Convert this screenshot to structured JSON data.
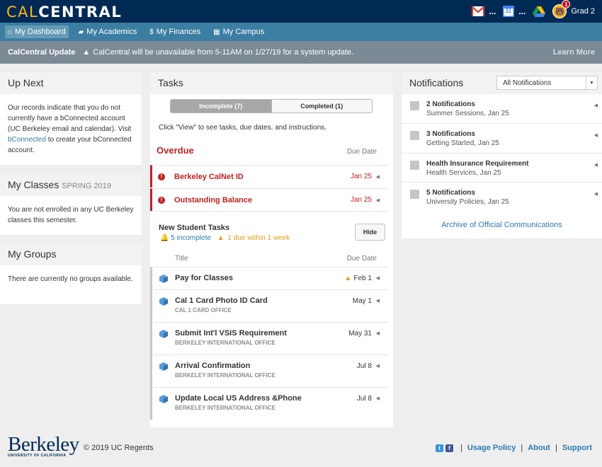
{
  "header": {
    "logo_left": "CAL",
    "logo_right": "CENTRAL",
    "more_dots": "...",
    "calendar_day": "31",
    "badge_count": "1",
    "user_name": "Grad 2"
  },
  "nav": {
    "items": [
      {
        "label": "My Dashboard",
        "icon": "home-icon",
        "active": true
      },
      {
        "label": "My Academics",
        "icon": "book-icon"
      },
      {
        "label": "My Finances",
        "icon": "dollar-icon"
      },
      {
        "label": "My Campus",
        "icon": "grid-icon"
      }
    ]
  },
  "alert": {
    "title": "CalCentral Update",
    "message": "CalCentral will be unavailable from 5-11AM on 1/27/19 for a system update.",
    "learn_more": "Learn More"
  },
  "up_next": {
    "title": "Up Next",
    "text_before": "Our records indicate that you do not currently have a bConnected account (UC Berkeley email and calendar). Visit ",
    "link": "bConnected",
    "text_after": " to create your bConnected account."
  },
  "my_classes": {
    "title": "My Classes",
    "term": "SPRING 2019",
    "text": "You are not enrolled in any UC Berkeley classes this semester."
  },
  "my_groups": {
    "title": "My Groups",
    "text": "There are currently no groups available."
  },
  "tasks": {
    "title": "Tasks",
    "tab_incomplete": "Incomplete (7)",
    "tab_completed": "Completed (1)",
    "instructions": "Click \"View\" to see tasks, due dates, and instructions.",
    "overdue_label": "Overdue",
    "due_date_header": "Due Date",
    "overdue": [
      {
        "title": "Berkeley CalNet ID",
        "due": "Jan 25"
      },
      {
        "title": "Outstanding Balance",
        "due": "Jan 25"
      }
    ],
    "new_student": {
      "title": "New Student Tasks",
      "incomplete": "5 incomplete",
      "due_soon": "1 due within 1 week",
      "hide_label": "Hide",
      "col_title": "Title",
      "col_due": "Due Date",
      "items": [
        {
          "title": "Pay for Classes",
          "sub": "",
          "due": "Feb 1",
          "warn": true
        },
        {
          "title": "Cal 1 Card Photo ID Card",
          "sub": "CAL 1 CARD OFFICE",
          "due": "May 1"
        },
        {
          "title": "Submit Int'l VSIS Requirement",
          "sub": "BERKELEY INTERNATIONAL OFFICE",
          "due": "May 31"
        },
        {
          "title": "Arrival Confirmation",
          "sub": "BERKELEY INTERNATIONAL OFFICE",
          "due": "Jul 8"
        },
        {
          "title": "Update Local US Address &Phone",
          "sub": "BERKELEY INTERNATIONAL OFFICE",
          "due": "Jul 8"
        }
      ]
    }
  },
  "notifications": {
    "title": "Notifications",
    "filter": "All Notifications",
    "items": [
      {
        "title": "2 Notifications",
        "sub": "Summer Sessions, Jan 25"
      },
      {
        "title": "3 Notifications",
        "sub": "Getting Started, Jan 25"
      },
      {
        "title": "Health Insurance Requirement",
        "sub": "Health Services, Jan 25"
      },
      {
        "title": "5 Notifications",
        "sub": "University Policies, Jan 25"
      }
    ],
    "archive": "Archive of Official Communications"
  },
  "footer": {
    "logo": "Berkeley",
    "logo_sub": "UNIVERSITY OF CALIFORNIA",
    "copyright": "© 2019 UC Regents",
    "links": {
      "usage": "Usage Policy",
      "about": "About",
      "support": "Support"
    }
  },
  "colors": {
    "header": "#002a54",
    "nav": "#3b7ea1",
    "alert": "#7b8a95",
    "overdue": "#c41f21",
    "link": "#2d7ab0",
    "gold": "#fdb515"
  }
}
